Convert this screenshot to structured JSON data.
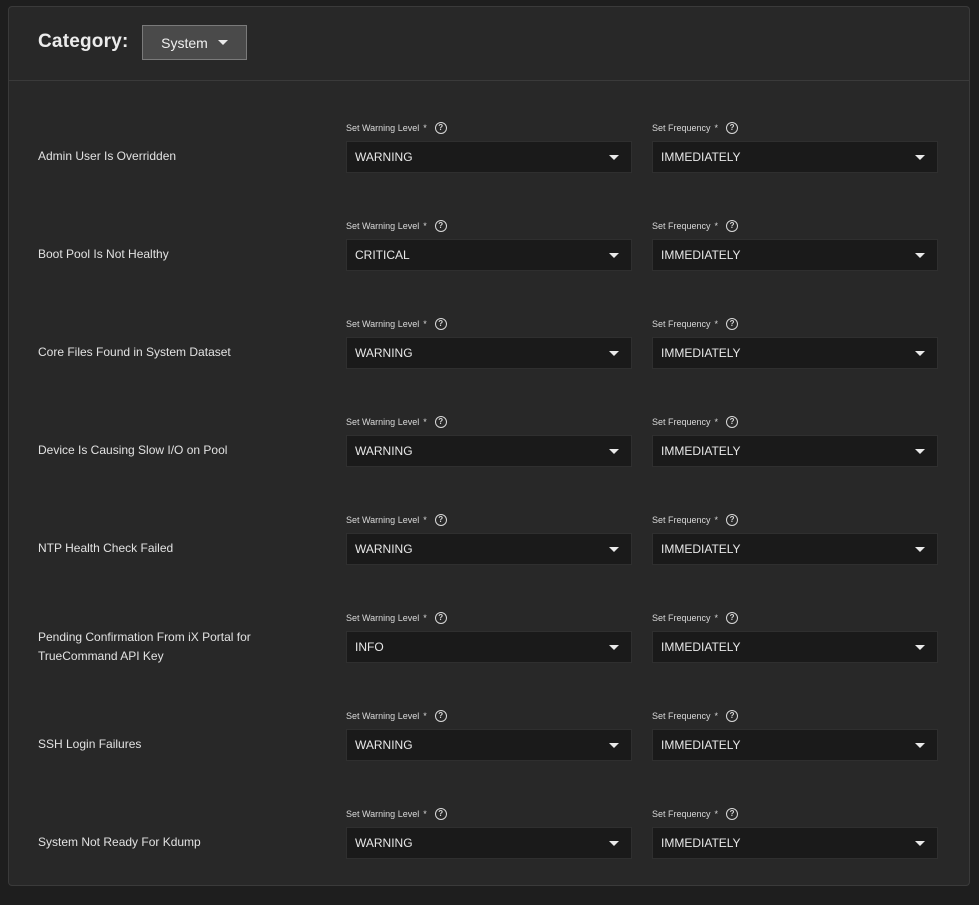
{
  "header": {
    "category_label": "Category:",
    "category_value": "System"
  },
  "field_labels": {
    "warning_level": "Set Warning Level",
    "frequency": "Set Frequency",
    "required_mark": "*"
  },
  "alerts": [
    {
      "name": "Admin User Is Overridden",
      "level": "WARNING",
      "frequency": "IMMEDIATELY"
    },
    {
      "name": "Boot Pool Is Not Healthy",
      "level": "CRITICAL",
      "frequency": "IMMEDIATELY"
    },
    {
      "name": "Core Files Found in System Dataset",
      "level": "WARNING",
      "frequency": "IMMEDIATELY"
    },
    {
      "name": "Device Is Causing Slow I/O on Pool",
      "level": "WARNING",
      "frequency": "IMMEDIATELY"
    },
    {
      "name": "NTP Health Check Failed",
      "level": "WARNING",
      "frequency": "IMMEDIATELY"
    },
    {
      "name": "Pending Confirmation From iX Portal for TrueCommand API Key",
      "level": "INFO",
      "frequency": "IMMEDIATELY"
    },
    {
      "name": "SSH Login Failures",
      "level": "WARNING",
      "frequency": "IMMEDIATELY"
    },
    {
      "name": "System Not Ready For Kdump",
      "level": "WARNING",
      "frequency": "IMMEDIATELY"
    }
  ],
  "icons": {
    "help": "help-circle-icon",
    "dropdown": "caret-down-icon"
  }
}
